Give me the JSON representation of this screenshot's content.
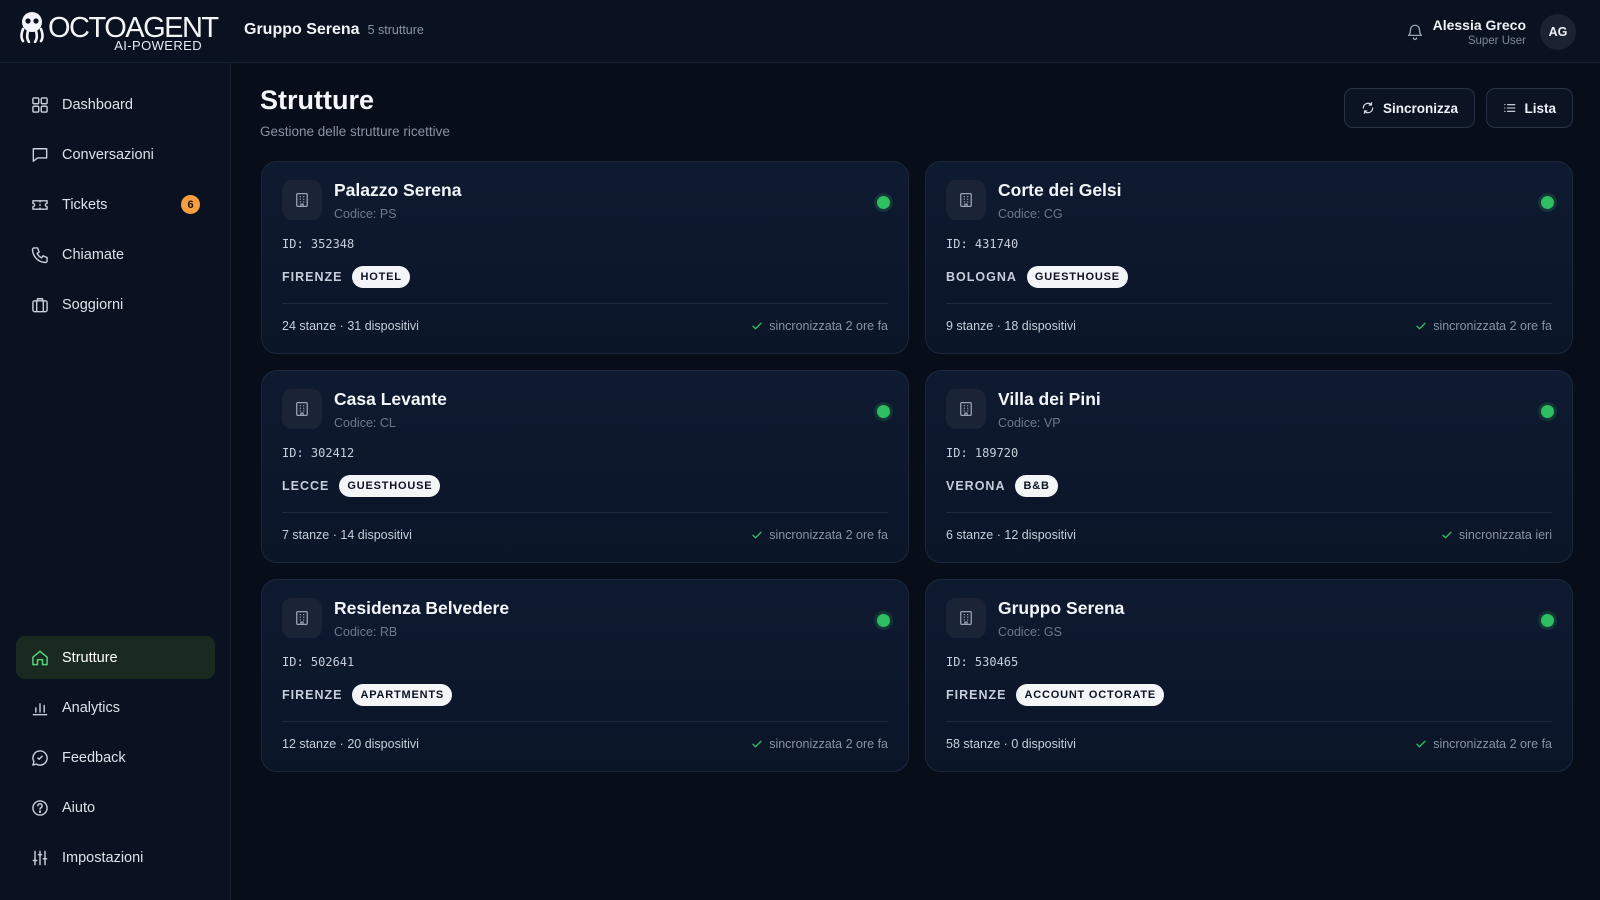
{
  "brand": {
    "name": "OCTOAGENT",
    "tagline": "AI-POWERED"
  },
  "header": {
    "org_name": "Gruppo Serena",
    "org_count": "5 strutture",
    "user_name": "Alessia Greco",
    "user_role": "Super User",
    "user_initials": "AG"
  },
  "sidebar": {
    "items": [
      {
        "label": "Dashboard",
        "icon": "grid-icon"
      },
      {
        "label": "Conversazioni",
        "icon": "chat-icon"
      },
      {
        "label": "Tickets",
        "icon": "ticket-icon",
        "badge": "6"
      },
      {
        "label": "Chiamate",
        "icon": "phone-icon"
      },
      {
        "label": "Soggiorni",
        "icon": "luggage-icon"
      },
      {
        "label": "Strutture",
        "icon": "home-icon",
        "active": true
      },
      {
        "label": "Analytics",
        "icon": "bar-chart-icon"
      },
      {
        "label": "Feedback",
        "icon": "feedback-icon"
      },
      {
        "label": "Aiuto",
        "icon": "help-icon"
      },
      {
        "label": "Impostazioni",
        "icon": "sliders-icon"
      }
    ]
  },
  "main": {
    "title": "Strutture",
    "subtitle": "Gestione delle strutture ricettive",
    "sync_label": "Sincronizza",
    "list_label": "Lista"
  },
  "properties": [
    {
      "name": "Palazzo Serena",
      "code": "Codice: PS",
      "id": "ID: 352348",
      "city": "FIRENZE",
      "type": "HOTEL",
      "stats": "24 stanze · 31 dispositivi",
      "sync": "sincronizzata 2 ore fa"
    },
    {
      "name": "Corte dei Gelsi",
      "code": "Codice: CG",
      "id": "ID: 431740",
      "city": "BOLOGNA",
      "type": "GUESTHOUSE",
      "stats": "9 stanze · 18 dispositivi",
      "sync": "sincronizzata 2 ore fa"
    },
    {
      "name": "Casa Levante",
      "code": "Codice: CL",
      "id": "ID: 302412",
      "city": "LECCE",
      "type": "GUESTHOUSE",
      "stats": "7 stanze · 14 dispositivi",
      "sync": "sincronizzata 2 ore fa"
    },
    {
      "name": "Villa dei Pini",
      "code": "Codice: VP",
      "id": "ID: 189720",
      "city": "VERONA",
      "type": "B&B",
      "stats": "6 stanze · 12 dispositivi",
      "sync": "sincronizzata ieri"
    },
    {
      "name": "Residenza Belvedere",
      "code": "Codice: RB",
      "id": "ID: 502641",
      "city": "FIRENZE",
      "type": "APARTMENTS",
      "stats": "12 stanze · 20 dispositivi",
      "sync": "sincronizzata 2 ore fa"
    },
    {
      "name": "Gruppo Serena",
      "code": "Codice: GS",
      "id": "ID: 530465",
      "city": "FIRENZE",
      "type": "ACCOUNT OCTORATE",
      "stats": "58 stanze · 0 dispositivi",
      "sync": "sincronizzata 2 ore fa"
    }
  ],
  "colors": {
    "status_online": "#2fbf62",
    "badge": "#f59e42",
    "active_nav": "#1a2a20"
  }
}
